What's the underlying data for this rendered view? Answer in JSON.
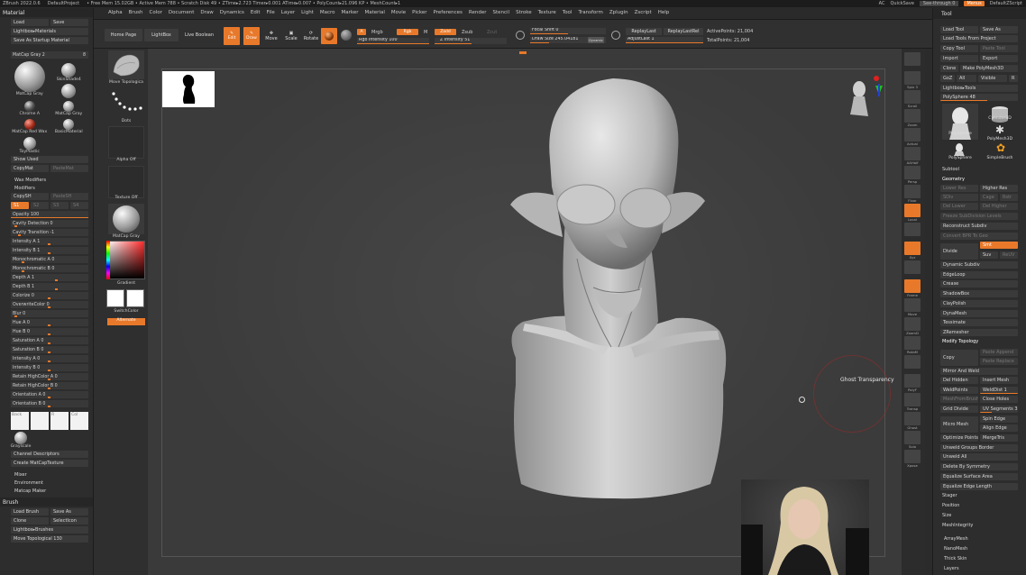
{
  "titlebar": {
    "app": "ZBrush 2022.0.6",
    "project": "DefaultProject",
    "stats": "• Free Mem 15.02GB • Active Mem 788 • Scratch Disk 49 • ZTime▸2.723 Timer▸0.001 ATime▸0.007 • PolyCount▸21.096 KP • MeshCount▸1",
    "ac": "AC",
    "quicksave": "QuickSave",
    "seethrough": "See-through  0",
    "menus": "Menus",
    "script": "DefaultZScript"
  },
  "menubar": {
    "items": [
      "Alpha",
      "Brush",
      "Color",
      "Document",
      "Draw",
      "Dynamics",
      "Edit",
      "File",
      "Layer",
      "Light",
      "Macro",
      "Marker",
      "Material",
      "Movie",
      "Picker",
      "Preferences",
      "Render",
      "Stencil",
      "Stroke",
      "Texture",
      "Tool",
      "Transform",
      "Zplugin",
      "Zscript",
      "Help"
    ]
  },
  "left": {
    "material_title": "Material",
    "load": "Load",
    "save": "Save",
    "lightbox_materials": "Lightbox▸Materials",
    "save_startup": "Save As Startup Material",
    "current_mat": "MatCap Gray  2",
    "current_mat_num": "8",
    "materials": [
      "MatCap Gray",
      "SkinShade4",
      "Chrome A",
      "MatCap Gray",
      "MatCap Red Wax",
      "BasicMaterial",
      "ToyPlastic"
    ],
    "show_used": "Show Used",
    "copymat": "CopyMat",
    "pastemat": "PasteMat",
    "wax_modifiers": "Wax Modifiers",
    "modifiers": "Modifiers",
    "copysh": "CopySH",
    "pastesh": "PasteSH",
    "s_tabs": [
      "S1",
      "S2",
      "S3",
      "S4"
    ],
    "sliders": [
      "Opacity 100",
      "Cavity Detection 0",
      "Cavity Transition -1",
      "Intensity A 1",
      "Intensity B 1",
      "Monochromatic A 0",
      "Monochromatic B 0",
      "Depth A 1",
      "Depth B 1",
      "Colorize 0",
      "OverwriteColor 0",
      "Blur 0",
      "Hue A 0",
      "Hue B 0",
      "Saturation A 0",
      "Saturation B 0",
      "Intensity A 0",
      "Intensity B 0",
      "Retain HighColor A 0",
      "Retain HighColor B 0",
      "Orientation A 0",
      "Orientation B 0"
    ],
    "swatches": [
      "Back",
      "",
      "R",
      "Col"
    ],
    "grayscale": "Grayscale",
    "channel_desc": "Channel Descriptors",
    "create_matcap": "Create MatCapTexture",
    "mixer": "Mixer",
    "environment": "Environment",
    "matcap_maker": "Matcap Maker",
    "brush_title": "Brush",
    "load_brush": "Load Brush",
    "save_as": "Save As",
    "clone": "Clone",
    "select_icon": "SelectIcon",
    "lightbox_brushes": "Lightbox▸Brushes",
    "more": "Move Topological  130"
  },
  "toolbar": {
    "home_page": "Home Page",
    "lightbox": "LightBox",
    "live_boolean": "Live Boolean",
    "edit": "Edit",
    "draw": "Draw",
    "move": "Move",
    "scale": "Scale",
    "rotate": "Rotate",
    "a": "A",
    "mrgb": "Mrgb",
    "rgb": "Rgb",
    "m": "M",
    "zadd": "Zadd",
    "zsub": "Zsub",
    "zcut": "Zcut",
    "rgb_intensity": "Rgb Intensity 100",
    "z_intensity": "Z Intensity 51",
    "focal_shift": "Focal Shift 0",
    "draw_size": "Draw Size 245.04181",
    "dynamic": "Dynamic",
    "replay_last": "ReplayLast",
    "replay_last_rel": "ReplayLastRel",
    "adjust_last": "AdjustLast 1",
    "active_points": "ActivePoints: 21,004",
    "total_points": "TotalPoints: 21,004"
  },
  "shelf": {
    "brush": "Move Topologica",
    "stroke": "Dots",
    "alpha": "Alpha Off",
    "texture": "Texture Off",
    "material": "MatCap Gray",
    "gradient": "Gradient",
    "switch_color": "SwitchColor",
    "alternate": "Alternate"
  },
  "canvas": {
    "tooltip": "Ghost Transparency"
  },
  "rshelf": {
    "labels": [
      "",
      "Spix 3",
      "Scroll",
      "Zoom",
      "Actual",
      "AAHalf",
      "Persp",
      "Floor",
      "Local",
      "",
      "Xyz",
      "",
      "Frame",
      "Move",
      "ZoomD",
      "RotaM",
      "",
      "PolyF",
      "Transp",
      "Ghost",
      "Solo",
      "Xpose"
    ]
  },
  "right": {
    "tool_title": "Tool",
    "load_tool": "Load Tool",
    "save_as": "Save As",
    "load_from_project": "Load Tools From Project",
    "copy_tool": "Copy Tool",
    "paste_tool": "Paste Tool",
    "import": "Import",
    "export": "Export",
    "clone": "Clone",
    "make_polymesh": "Make PolyMesh3D",
    "goz": "GoZ",
    "all": "All",
    "visible": "Visible",
    "r": "R",
    "lightbox_tools": "Lightbox▸Tools",
    "polysphere": "PolySphere  48",
    "tools": [
      "PolySphere",
      "Cylinder3D",
      "PolySphere",
      "PolyMesh3D",
      "PolySphere",
      "SimpleBrush"
    ],
    "subtool": "Subtool",
    "geometry": "Geometry",
    "lower_res": "Lower Res",
    "higher_res": "Higher Res",
    "sdiv": "SDiv",
    "cage": "Cage",
    "rstr": "Rstr",
    "del_lower": "Del Lower",
    "del_higher": "Del Higher",
    "freeze_sub": "Freeze SubDivision Levels",
    "reconstruct": "Reconstruct Subdiv",
    "convert_bpr": "Convert BPR To Geo",
    "divide": "Divide",
    "smt": "Smt",
    "suv": "Suv",
    "reuv": "ReUV",
    "items": [
      "Dynamic Subdiv",
      "EdgeLoop",
      "Crease",
      "ShadowBox",
      "ClayPolish",
      "DynaMesh",
      "Tessimate",
      "ZRemesher"
    ],
    "modify_topology": "Modify Topology",
    "copy": "Copy",
    "paste_append": "Paste Append",
    "paste_replace": "Paste Replace",
    "mirror_weld": "Mirror And Weld",
    "del_hidden": "Del Hidden",
    "insert_mesh": "Insert Mesh",
    "weld_points": "WeldPoints",
    "weld_dist": "WeldDist 1",
    "mesh_from_brush": "MeshFromBrush",
    "close_holes": "Close Holes",
    "grid_divide": "Grid Divide",
    "uv_segments": "UV Segments 3",
    "spin_edge": "Spin Edge",
    "micro_mesh": "Micro Mesh",
    "align_edge": "Align Edge",
    "optimize_points": "Optimize Points",
    "merge_tris": "MergeTris",
    "unweld_groups": "Unweld Groups Border",
    "unweld_all": "Unweld All",
    "delete_by_symmetry": "Delete By Symmetry",
    "equalize_area": "Equalize Surface Area",
    "equalize_edge": "Equalize Edge Length",
    "stager": "Stager",
    "position": "Position",
    "size": "Size",
    "mesh_integrity": "MeshIntegrity",
    "array_mesh": "ArrayMesh",
    "nano_mesh": "NanoMesh",
    "thick_skin": "Thick Skin",
    "layers": "Layers"
  },
  "colors": {
    "accent": "#e8792a",
    "panel": "#2d2d2d",
    "canvas": "#3a3a3a"
  }
}
